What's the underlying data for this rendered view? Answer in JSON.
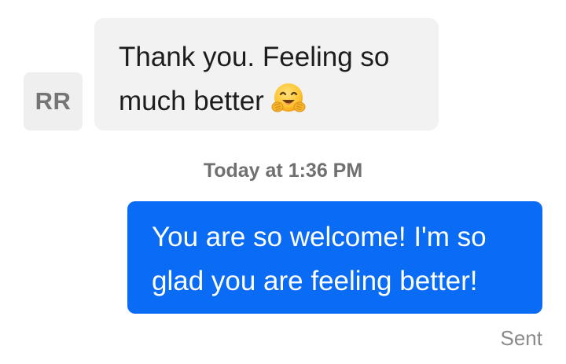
{
  "incoming": {
    "avatar_initials": "RR",
    "line1": "Thank you. Feeling so",
    "line2": "much better",
    "emoji_icon": "hugging-face-icon"
  },
  "timestamp": "Today at 1:36 PM",
  "outgoing": {
    "line1": "You are so welcome! I'm so",
    "line2": "glad you are feeling better!",
    "status": "Sent"
  },
  "colors": {
    "outgoing_bubble": "#0a6cf5",
    "incoming_bubble": "#f2f2f2",
    "avatar_bg": "#efefef",
    "timestamp_text": "#707070",
    "status_text": "#8a8a8a"
  }
}
